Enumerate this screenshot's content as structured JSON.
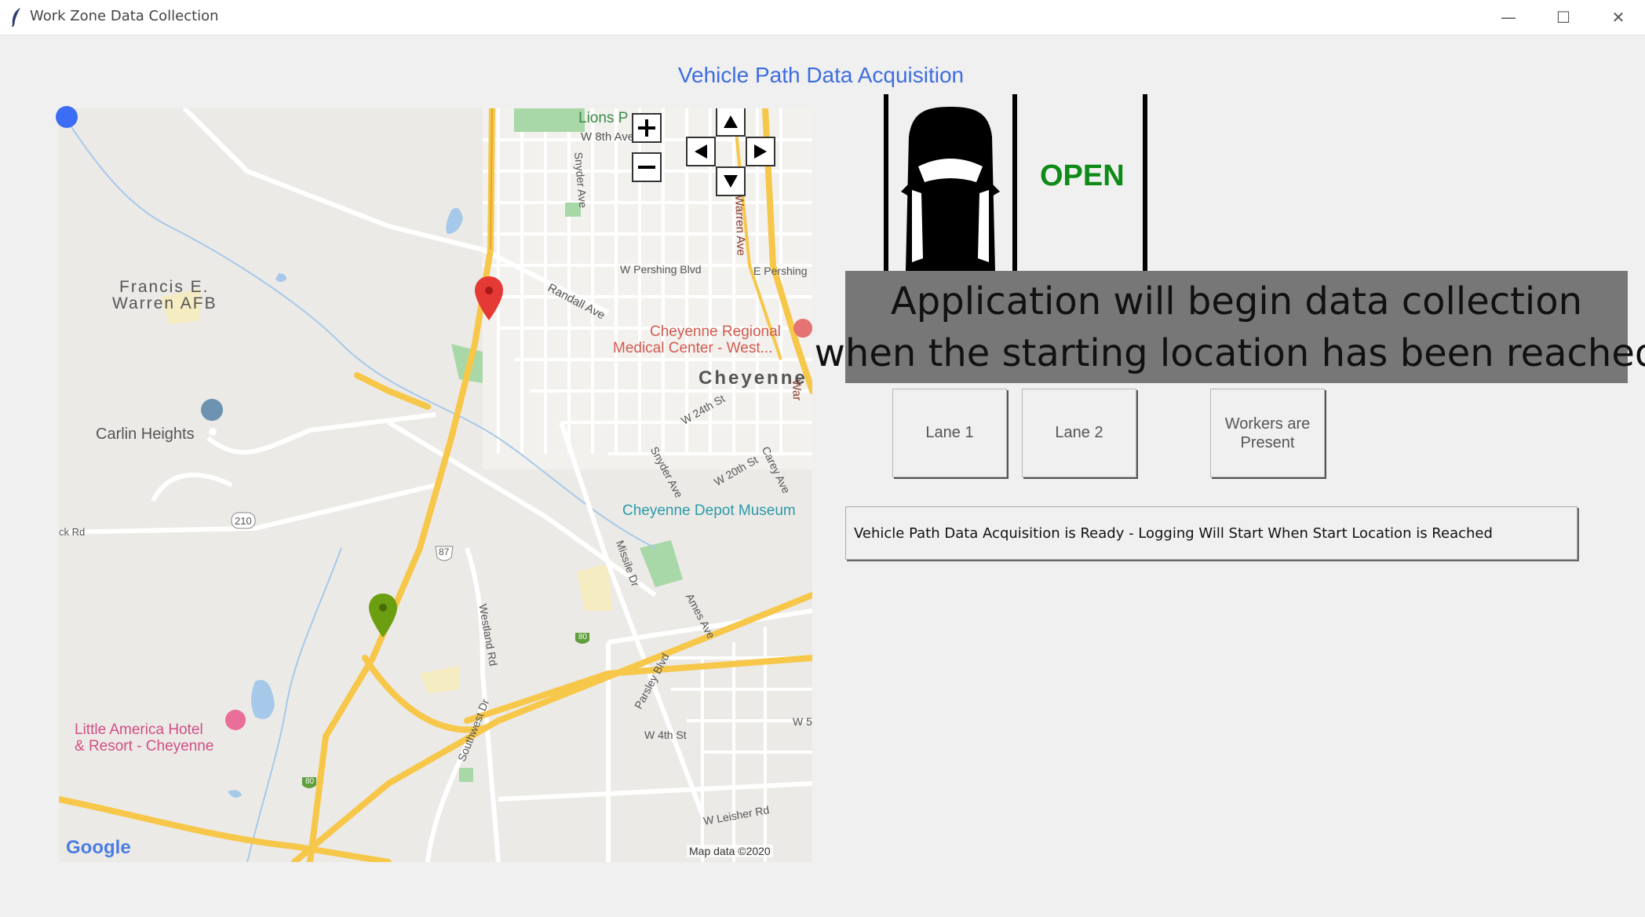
{
  "window": {
    "title": "Work Zone Data Collection",
    "controls": {
      "minimize": "—",
      "maximize": "☐",
      "close": "✕"
    }
  },
  "heading": "Vehicle Path Data Acquisition",
  "map": {
    "labels": {
      "lions_park": "Lions P",
      "w8th": "W 8th Ave",
      "snyder_top": "Snyder Ave",
      "warren": "Warren Ave",
      "pershing": "W Pershing Blvd",
      "e_pershing": "E Pershing",
      "randall": "Randall Ave",
      "afb1": "Francis E.",
      "afb2": "Warren AFB",
      "hospital1": "Cheyenne Regional",
      "hospital2": "Medical Center - West...",
      "cheyenne": "Cheyenne",
      "w24": "W 24th St",
      "carlin": "Carlin Heights",
      "snyder_mid": "Snyder Ave",
      "w20": "W 20th St",
      "carey": "Carey Ave",
      "war": "War",
      "route210": "210",
      "depot": "Cheyenne Depot Museum",
      "ck_rd": "ck Rd",
      "route87": "87",
      "missile": "Missile Dr",
      "ames": "Ames Ave",
      "westland": "Westland Rd",
      "i80_a": "80",
      "parsley": "Parsley Blvd",
      "hotel1": "Little America Hotel",
      "hotel2": "& Resort - Cheyenne",
      "southwest": "Southwest Dr",
      "w4th": "W 4th St",
      "w5": "W 5",
      "i80_b": "80",
      "leisher": "W Leisher Rd",
      "google": "Google",
      "mapdata": "Map data ©2020"
    },
    "colors": {
      "highway": "#f7c74a",
      "road": "#ffffff",
      "park": "#a8d8a8",
      "water": "#a6c9ea",
      "start_marker": "#6b9e10",
      "end_marker": "#e53935",
      "position_dot": "#3b6ef5"
    },
    "zoom_controls": [
      "zoom-in",
      "zoom-out"
    ],
    "pan_controls": [
      "pan-up",
      "pan-left",
      "pan-right",
      "pan-down"
    ]
  },
  "lane_status": {
    "text": "OPEN",
    "color": "#0e8a16"
  },
  "banner": {
    "line1": "Application will begin data collection",
    "line2": "when the starting location has been reached"
  },
  "buttons": {
    "lane1": "Lane 1",
    "lane2": "Lane 2",
    "workers": "Workers are Present"
  },
  "status_message": "Vehicle Path Data Acquisition is Ready - Logging Will Start When Start Location is Reached"
}
